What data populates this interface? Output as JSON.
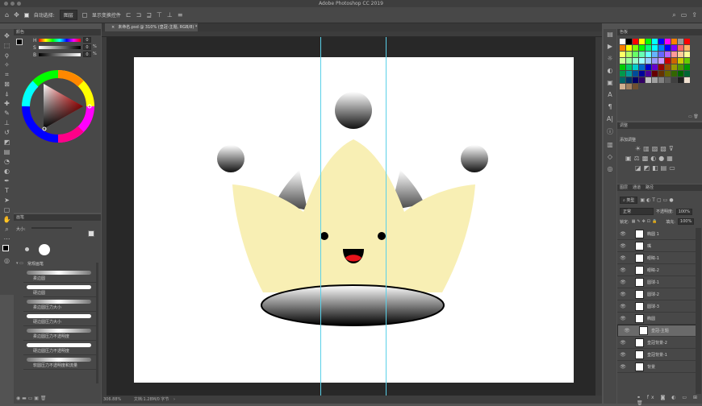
{
  "app": {
    "title": "Adobe Photoshop CC 2019"
  },
  "options_bar": {
    "auto_select_label": "自动选择:",
    "auto_select_value": "图层",
    "show_transform_label": "显示变换控件"
  },
  "document": {
    "tab_label": "未命名.psd @ 310% (皇冠-主题, RGB/8) *",
    "zoom": "306.88%",
    "doc_info": "文档:1.28M/0 字节"
  },
  "color_panel": {
    "title": "颜色",
    "channels": [
      "H",
      "S",
      "B"
    ],
    "values": [
      "0",
      "0",
      "0"
    ],
    "unit": "%"
  },
  "swatches_panel": {
    "title": "色板",
    "colors": [
      "#ffffff",
      "#000000",
      "#ff0000",
      "#ffff00",
      "#00ff00",
      "#00ffff",
      "#0000ff",
      "#ff00ff",
      "#ff8000",
      "#999999",
      "#ff0000",
      "#ff8000",
      "#ffff00",
      "#80ff00",
      "#00ff00",
      "#00ff80",
      "#00ffff",
      "#0080ff",
      "#0000ff",
      "#8000ff",
      "#ff6666",
      "#ffb366",
      "#ffff66",
      "#b3ff66",
      "#66ff66",
      "#66ffb3",
      "#66ffff",
      "#66b3ff",
      "#6666ff",
      "#b366ff",
      "#ff9999",
      "#ffcc99",
      "#ffff99",
      "#ccff99",
      "#99ff99",
      "#99ffcc",
      "#99ffff",
      "#99ccff",
      "#9999ff",
      "#cc99ff",
      "#cc0000",
      "#cc6600",
      "#cccc00",
      "#66cc00",
      "#00cc00",
      "#00cc66",
      "#00cccc",
      "#0066cc",
      "#0000cc",
      "#6600cc",
      "#990000",
      "#994c00",
      "#999900",
      "#4c9900",
      "#009900",
      "#00994c",
      "#009999",
      "#004c99",
      "#000099",
      "#4c0099",
      "#660000",
      "#663300",
      "#666600",
      "#336600",
      "#006600",
      "#006633",
      "#006666",
      "#003366",
      "#000066",
      "#330066",
      "#c0c0c0",
      "#a0a0a0",
      "#808080",
      "#606060",
      "#404040",
      "#202020",
      "#f0e0d0",
      "#d0b090",
      "#a08060",
      "#705030"
    ]
  },
  "adjustments_panel": {
    "title": "调整",
    "subtitle": "添加调整"
  },
  "layers_panel": {
    "tabs": [
      "图层",
      "通道",
      "路径"
    ],
    "filter_label": "类型",
    "blend_mode": "正常",
    "opacity_label": "不透明度:",
    "opacity_value": "100%",
    "lock_label": "锁定:",
    "fill_label": "填充:",
    "fill_value": "100%",
    "layers": [
      {
        "name": "椭圆 1",
        "selected": false
      },
      {
        "name": "嘴",
        "selected": false
      },
      {
        "name": "眼睛-1",
        "selected": false
      },
      {
        "name": "眼睛-2",
        "selected": false
      },
      {
        "name": "圆球-1",
        "selected": false
      },
      {
        "name": "圆球-2",
        "selected": false
      },
      {
        "name": "圆球-3",
        "selected": false
      },
      {
        "name": "椭圆",
        "selected": false
      },
      {
        "name": "皇冠-主题",
        "selected": true
      },
      {
        "name": "皇冠背景-2",
        "selected": false
      },
      {
        "name": "皇冠背景-1",
        "selected": false
      },
      {
        "name": "背景",
        "selected": false
      }
    ]
  },
  "brush_panel": {
    "title": "画笔",
    "size_label": "大小:",
    "group_label": "常规画笔",
    "brushes": [
      "柔边圆",
      "硬边圆",
      "柔边圆压力大小",
      "硬边圆压力大小",
      "柔边圆压力不透明度",
      "硬边圆压力不透明度",
      "软圆压力不透明度和流量"
    ]
  },
  "colors": {
    "crown": "#f8efb4",
    "canvas_bg": "#282828",
    "guide": "#5ad0e8"
  }
}
